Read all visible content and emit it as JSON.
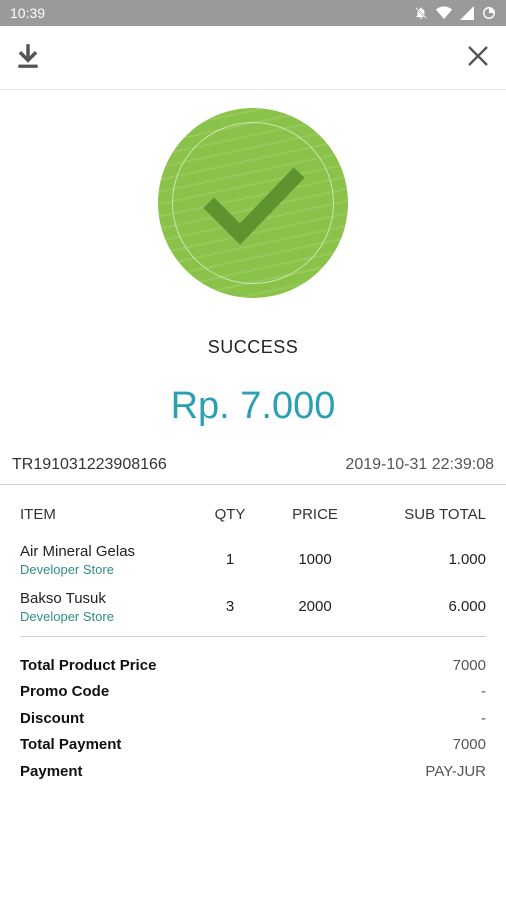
{
  "status_bar": {
    "time": "10:39",
    "icons": [
      "notifications-off-icon",
      "wifi-icon",
      "signal-icon",
      "battery-icon"
    ]
  },
  "toolbar": {
    "download_icon": "download-icon",
    "close_icon": "close-icon"
  },
  "result": {
    "badge_icon": "checkmark-icon",
    "status": "SUCCESS",
    "amount": "Rp. 7.000",
    "accent_color": "#2aa1b3",
    "badge_color": "#8bc34a"
  },
  "transaction": {
    "id": "TR191031223908166",
    "datetime": "2019-10-31 22:39:08"
  },
  "table": {
    "headers": [
      "ITEM",
      "QTY",
      "PRICE",
      "SUB TOTAL"
    ],
    "rows": [
      {
        "name": "Air Mineral Gelas",
        "store": "Developer Store",
        "qty": "1",
        "price": "1000",
        "subtotal": "1.000"
      },
      {
        "name": "Bakso Tusuk",
        "store": "Developer Store",
        "qty": "3",
        "price": "2000",
        "subtotal": "6.000"
      }
    ]
  },
  "summary": [
    {
      "label": "Total Product Price",
      "value": "7000"
    },
    {
      "label": "Promo Code",
      "value": "-"
    },
    {
      "label": "Discount",
      "value": "-"
    },
    {
      "label": "Total Payment",
      "value": "7000"
    },
    {
      "label": "Payment",
      "value": "PAY-JUR"
    }
  ]
}
